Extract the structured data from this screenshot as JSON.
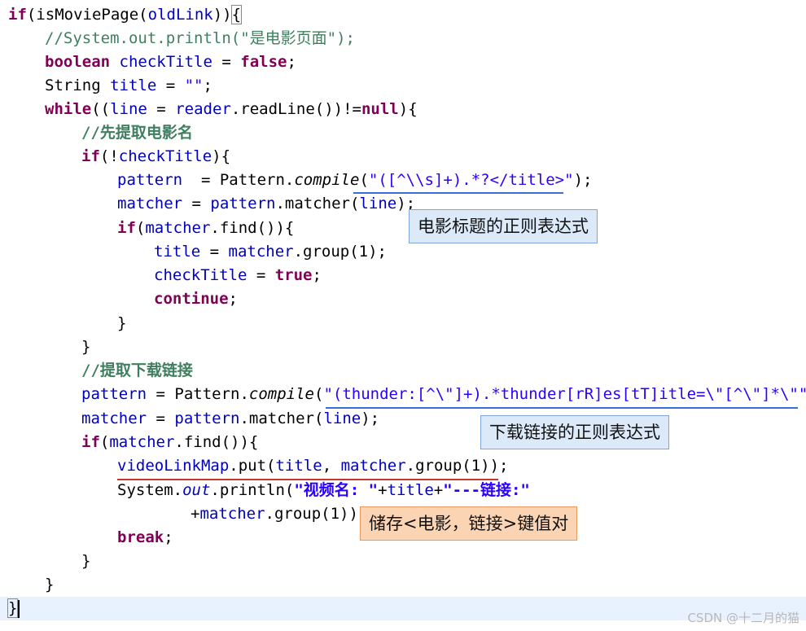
{
  "code": {
    "l1_if": "if",
    "l1_open": "(",
    "l1_fn": "isMoviePage(",
    "l1_arg": "oldLink",
    "l1_close": "))",
    "l1_brace": "{",
    "l2_comment": "//System.out.println(\"是电影页面\");",
    "l3_type": "boolean",
    "l3_var": " checkTitle",
    "l3_eq": " = ",
    "l3_val": "false",
    "l3_end": ";",
    "l4_type": "String",
    "l4_var": " title",
    "l4_eq": " = ",
    "l4_str": "\"\"",
    "l4_end": ";",
    "l5_kw": "while",
    "l5_a": "((",
    "l5_line": "line",
    "l5_b": " = ",
    "l5_reader": "reader",
    "l5_c": ".readLine())!=",
    "l5_null": "null",
    "l5_d": "){",
    "l6_comment": "//先提取电影名",
    "l7_if": "if",
    "l7_a": "(!",
    "l7_var": "checkTitle",
    "l7_b": "){",
    "l8_var": "pattern",
    "l8_a": "  = Pattern.",
    "l8_fn": "compile",
    "l8_b": "(",
    "l8_str": "\"([^\\\\s]+).*?</title>\"",
    "l8_c": ");",
    "l9_var": "matcher",
    "l9_a": " = ",
    "l9_var2": "pattern",
    "l9_b": ".matcher(",
    "l9_line": "line",
    "l9_c": ");",
    "l10_if": "if",
    "l10_a": "(",
    "l10_var": "matcher",
    "l10_b": ".find()){",
    "l11_var": "title",
    "l11_a": " = ",
    "l11_var2": "matcher",
    "l11_b": ".group(1);",
    "l12_var": "checkTitle",
    "l12_a": " = ",
    "l12_val": "true",
    "l12_b": ";",
    "l13_kw": "continue",
    "l13_a": ";",
    "l14": "}",
    "l15": "}",
    "l16_comment": "//提取下载链接",
    "l17_var": "pattern",
    "l17_a": " = Pattern.",
    "l17_fn": "compile",
    "l17_b": "(",
    "l17_str": "\"(thunder:[^\\\"]+).*thunder[rR]es[tT]itle=\\\"[^\\\"]*\\\"\"",
    "l17_c": ");",
    "l18_var": "matcher",
    "l18_a": " = ",
    "l18_var2": "pattern",
    "l18_b": ".matcher(",
    "l18_line": "line",
    "l18_c": ");",
    "l19_if": "if",
    "l19_a": "(",
    "l19_var": "matcher",
    "l19_b": ".find()){",
    "l20_var": "videoLinkMap",
    "l20_a": ".put(",
    "l20_var2": "title",
    "l20_b": ", ",
    "l20_var3": "matcher",
    "l20_c": ".group(1));",
    "l21_a": "System.",
    "l21_out": "out",
    "l21_b": ".println(",
    "l21_str1": "\"视频名: \"",
    "l21_c": "+",
    "l21_var": "title",
    "l21_d": "+",
    "l21_str2": "\"---链接:\"",
    "l22_a": "+",
    "l22_var": "matcher",
    "l22_b": ".group(1));",
    "l23_kw": "break",
    "l23_a": ";",
    "l24": "}",
    "l25": "}",
    "l26": "}"
  },
  "annotations": {
    "title_regex_note": "电影标题的正则表达式",
    "link_regex_note": "下载链接的正则表达式",
    "map_note": "储存<电影，链接>键值对"
  },
  "watermark": "CSDN @十二月的猫",
  "colors": {
    "keyword": "#7f0055",
    "comment": "#3f7f5f",
    "string": "#2a00ff",
    "field": "#0000c0",
    "note_blue_bg": "#dce9f8",
    "note_orange_bg": "#fbd4b4",
    "underline_blue": "#3a6fd8",
    "underline_red": "#c0392b"
  }
}
